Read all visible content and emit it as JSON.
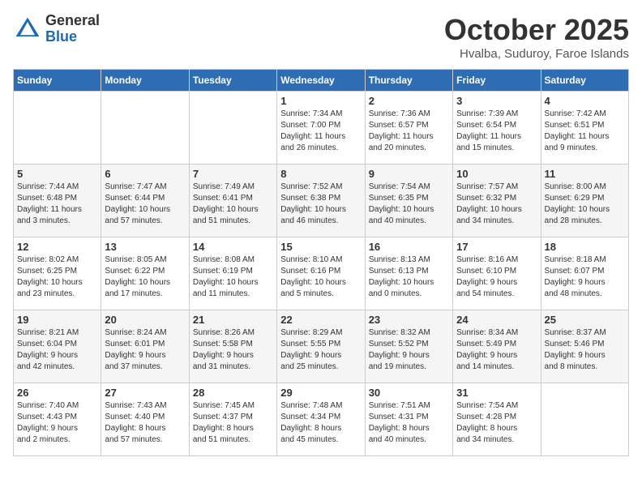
{
  "logo": {
    "general": "General",
    "blue": "Blue"
  },
  "title": "October 2025",
  "subtitle": "Hvalba, Suduroy, Faroe Islands",
  "days_of_week": [
    "Sunday",
    "Monday",
    "Tuesday",
    "Wednesday",
    "Thursday",
    "Friday",
    "Saturday"
  ],
  "weeks": [
    [
      {
        "day": "",
        "info": ""
      },
      {
        "day": "",
        "info": ""
      },
      {
        "day": "",
        "info": ""
      },
      {
        "day": "1",
        "info": "Sunrise: 7:34 AM\nSunset: 7:00 PM\nDaylight: 11 hours\nand 26 minutes."
      },
      {
        "day": "2",
        "info": "Sunrise: 7:36 AM\nSunset: 6:57 PM\nDaylight: 11 hours\nand 20 minutes."
      },
      {
        "day": "3",
        "info": "Sunrise: 7:39 AM\nSunset: 6:54 PM\nDaylight: 11 hours\nand 15 minutes."
      },
      {
        "day": "4",
        "info": "Sunrise: 7:42 AM\nSunset: 6:51 PM\nDaylight: 11 hours\nand 9 minutes."
      }
    ],
    [
      {
        "day": "5",
        "info": "Sunrise: 7:44 AM\nSunset: 6:48 PM\nDaylight: 11 hours\nand 3 minutes."
      },
      {
        "day": "6",
        "info": "Sunrise: 7:47 AM\nSunset: 6:44 PM\nDaylight: 10 hours\nand 57 minutes."
      },
      {
        "day": "7",
        "info": "Sunrise: 7:49 AM\nSunset: 6:41 PM\nDaylight: 10 hours\nand 51 minutes."
      },
      {
        "day": "8",
        "info": "Sunrise: 7:52 AM\nSunset: 6:38 PM\nDaylight: 10 hours\nand 46 minutes."
      },
      {
        "day": "9",
        "info": "Sunrise: 7:54 AM\nSunset: 6:35 PM\nDaylight: 10 hours\nand 40 minutes."
      },
      {
        "day": "10",
        "info": "Sunrise: 7:57 AM\nSunset: 6:32 PM\nDaylight: 10 hours\nand 34 minutes."
      },
      {
        "day": "11",
        "info": "Sunrise: 8:00 AM\nSunset: 6:29 PM\nDaylight: 10 hours\nand 28 minutes."
      }
    ],
    [
      {
        "day": "12",
        "info": "Sunrise: 8:02 AM\nSunset: 6:25 PM\nDaylight: 10 hours\nand 23 minutes."
      },
      {
        "day": "13",
        "info": "Sunrise: 8:05 AM\nSunset: 6:22 PM\nDaylight: 10 hours\nand 17 minutes."
      },
      {
        "day": "14",
        "info": "Sunrise: 8:08 AM\nSunset: 6:19 PM\nDaylight: 10 hours\nand 11 minutes."
      },
      {
        "day": "15",
        "info": "Sunrise: 8:10 AM\nSunset: 6:16 PM\nDaylight: 10 hours\nand 5 minutes."
      },
      {
        "day": "16",
        "info": "Sunrise: 8:13 AM\nSunset: 6:13 PM\nDaylight: 10 hours\nand 0 minutes."
      },
      {
        "day": "17",
        "info": "Sunrise: 8:16 AM\nSunset: 6:10 PM\nDaylight: 9 hours\nand 54 minutes."
      },
      {
        "day": "18",
        "info": "Sunrise: 8:18 AM\nSunset: 6:07 PM\nDaylight: 9 hours\nand 48 minutes."
      }
    ],
    [
      {
        "day": "19",
        "info": "Sunrise: 8:21 AM\nSunset: 6:04 PM\nDaylight: 9 hours\nand 42 minutes."
      },
      {
        "day": "20",
        "info": "Sunrise: 8:24 AM\nSunset: 6:01 PM\nDaylight: 9 hours\nand 37 minutes."
      },
      {
        "day": "21",
        "info": "Sunrise: 8:26 AM\nSunset: 5:58 PM\nDaylight: 9 hours\nand 31 minutes."
      },
      {
        "day": "22",
        "info": "Sunrise: 8:29 AM\nSunset: 5:55 PM\nDaylight: 9 hours\nand 25 minutes."
      },
      {
        "day": "23",
        "info": "Sunrise: 8:32 AM\nSunset: 5:52 PM\nDaylight: 9 hours\nand 19 minutes."
      },
      {
        "day": "24",
        "info": "Sunrise: 8:34 AM\nSunset: 5:49 PM\nDaylight: 9 hours\nand 14 minutes."
      },
      {
        "day": "25",
        "info": "Sunrise: 8:37 AM\nSunset: 5:46 PM\nDaylight: 9 hours\nand 8 minutes."
      }
    ],
    [
      {
        "day": "26",
        "info": "Sunrise: 7:40 AM\nSunset: 4:43 PM\nDaylight: 9 hours\nand 2 minutes."
      },
      {
        "day": "27",
        "info": "Sunrise: 7:43 AM\nSunset: 4:40 PM\nDaylight: 8 hours\nand 57 minutes."
      },
      {
        "day": "28",
        "info": "Sunrise: 7:45 AM\nSunset: 4:37 PM\nDaylight: 8 hours\nand 51 minutes."
      },
      {
        "day": "29",
        "info": "Sunrise: 7:48 AM\nSunset: 4:34 PM\nDaylight: 8 hours\nand 45 minutes."
      },
      {
        "day": "30",
        "info": "Sunrise: 7:51 AM\nSunset: 4:31 PM\nDaylight: 8 hours\nand 40 minutes."
      },
      {
        "day": "31",
        "info": "Sunrise: 7:54 AM\nSunset: 4:28 PM\nDaylight: 8 hours\nand 34 minutes."
      },
      {
        "day": "",
        "info": ""
      }
    ]
  ]
}
